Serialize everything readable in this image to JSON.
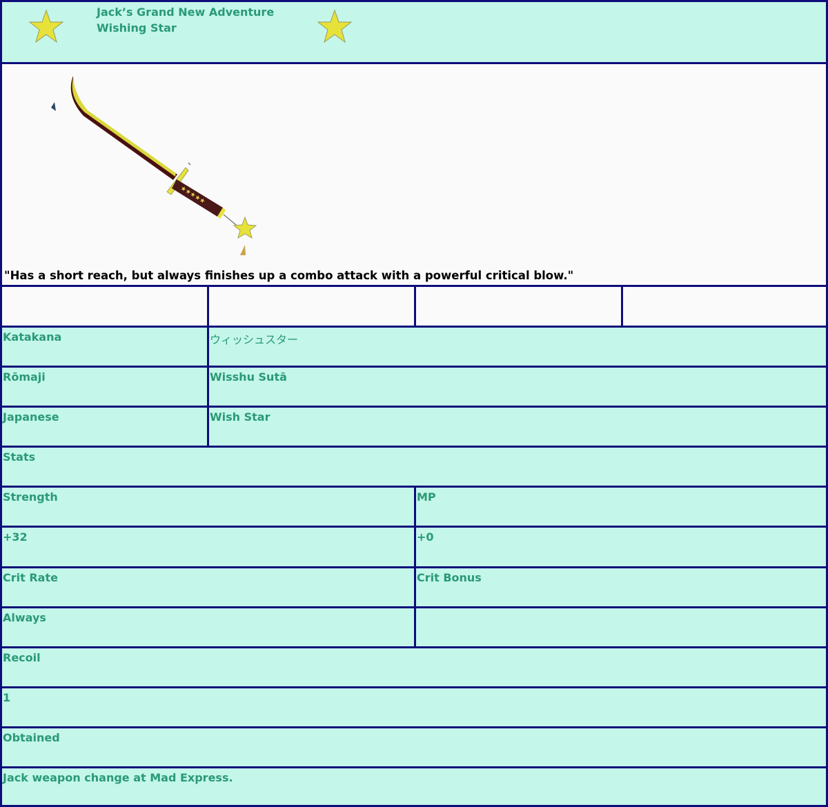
{
  "header": {
    "series": "Jack’s Grand New Adventure",
    "name": "Wishing Star",
    "icons": [
      "star-icon",
      "star-icon"
    ]
  },
  "description": "\"Has a short reach, but always finishes up a combo attack with a powerful critical blow.\"",
  "names": {
    "katakana_label": "Katakana",
    "katakana_value": "ウィッシュスター",
    "romaji_label": "Rōmaji",
    "romaji_value": "Wisshu Sutā",
    "japanese_label": "Japanese",
    "japanese_value": "Wish Star"
  },
  "stats": {
    "heading": "Stats",
    "strength_label": "Strength",
    "mp_label": "MP",
    "strength_value": "+32",
    "mp_value": "+0",
    "crit_rate_label": "Crit Rate",
    "crit_bonus_label": "Crit Bonus",
    "crit_rate_value": "Always",
    "crit_bonus_value": "",
    "recoil_label": "Recoil",
    "recoil_value": "1",
    "obtained_label": "Obtained",
    "obtained_value": "Jack weapon change at Mad Express."
  },
  "colors": {
    "border": "#0d0d7a",
    "cell_bg": "#c4f6ea",
    "text": "#2a9a76",
    "star": "#e6e23a"
  }
}
